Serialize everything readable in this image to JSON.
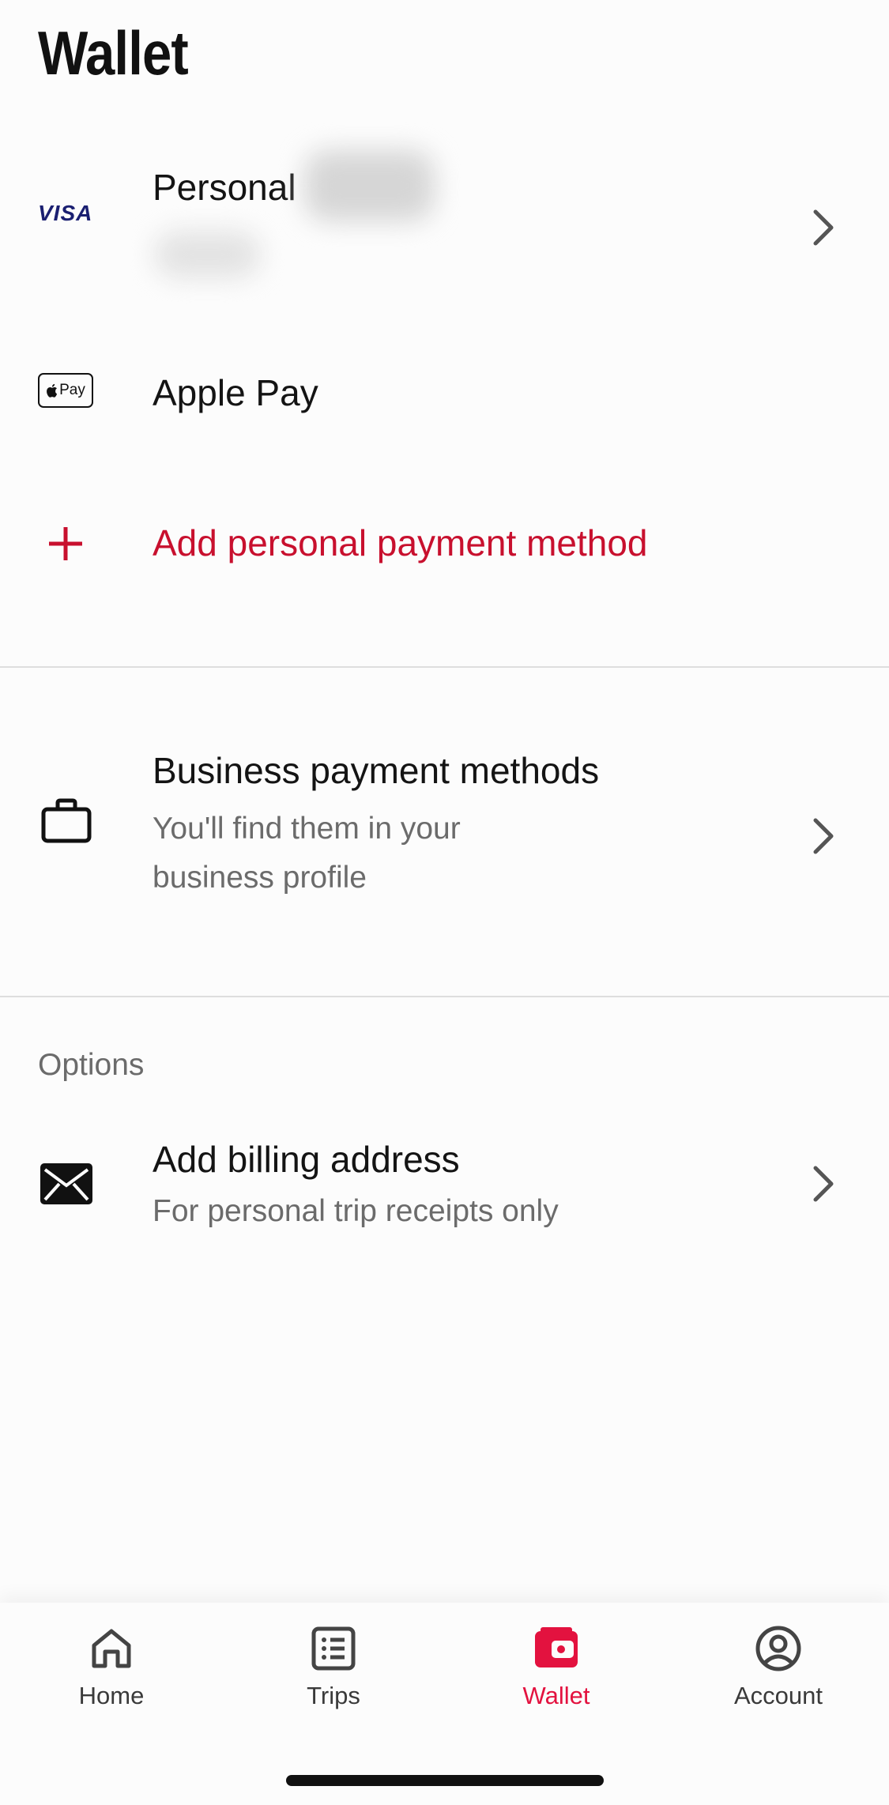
{
  "page": {
    "title": "Wallet"
  },
  "personal_methods": {
    "visa": {
      "brand": "VISA",
      "label": "Personal"
    },
    "apple_pay": {
      "badge": "Pay",
      "label": "Apple Pay"
    },
    "add": {
      "label": "Add personal payment method"
    }
  },
  "business": {
    "title": "Business payment methods",
    "subtitle_line1": "You'll find them in your",
    "subtitle_line2": "business profile"
  },
  "options": {
    "header": "Options",
    "billing": {
      "title": "Add billing address",
      "subtitle": "For personal trip receipts only"
    }
  },
  "tabs": [
    {
      "label": "Home",
      "icon": "home-icon",
      "active": false
    },
    {
      "label": "Trips",
      "icon": "list-icon",
      "active": false
    },
    {
      "label": "Wallet",
      "icon": "wallet-icon",
      "active": true
    },
    {
      "label": "Account",
      "icon": "account-icon",
      "active": false
    }
  ],
  "colors": {
    "accent": "#c8102e",
    "text": "#141414",
    "muted": "#6b6b6b",
    "visa_blue": "#1a1f71"
  }
}
